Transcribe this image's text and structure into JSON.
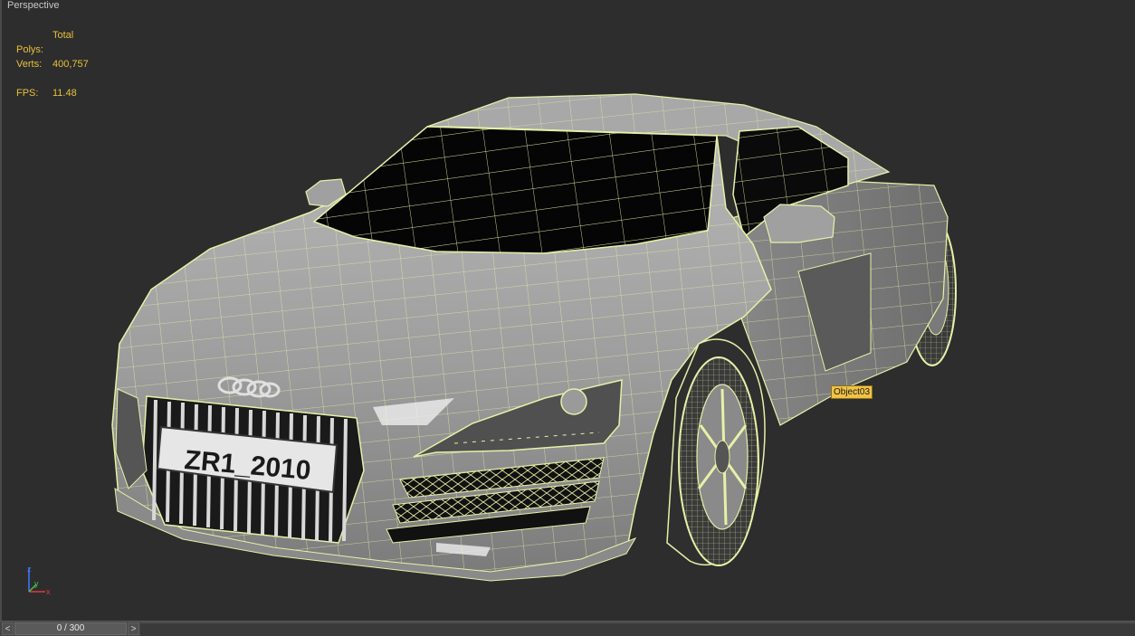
{
  "viewport": {
    "label": "Perspective",
    "object_label": "Object03",
    "plate_text": "ZR1_2010"
  },
  "stats": {
    "header": "Total",
    "polys_label": "Polys:",
    "polys_value": "",
    "verts_label": "Verts:",
    "verts_value": "400,757",
    "fps_label": "FPS:",
    "fps_value": "11.48"
  },
  "gizmo": {
    "x": "x",
    "y": "y",
    "z": "z"
  },
  "timeslider": {
    "prev_label": "<",
    "next_label": ">",
    "frame_text": "0 / 300"
  },
  "colors": {
    "background": "#2d2d2d",
    "wire": "#e8f0a8",
    "body": "#9a9a9a",
    "stats": "#e8c13a",
    "tag": "#f0c245"
  }
}
